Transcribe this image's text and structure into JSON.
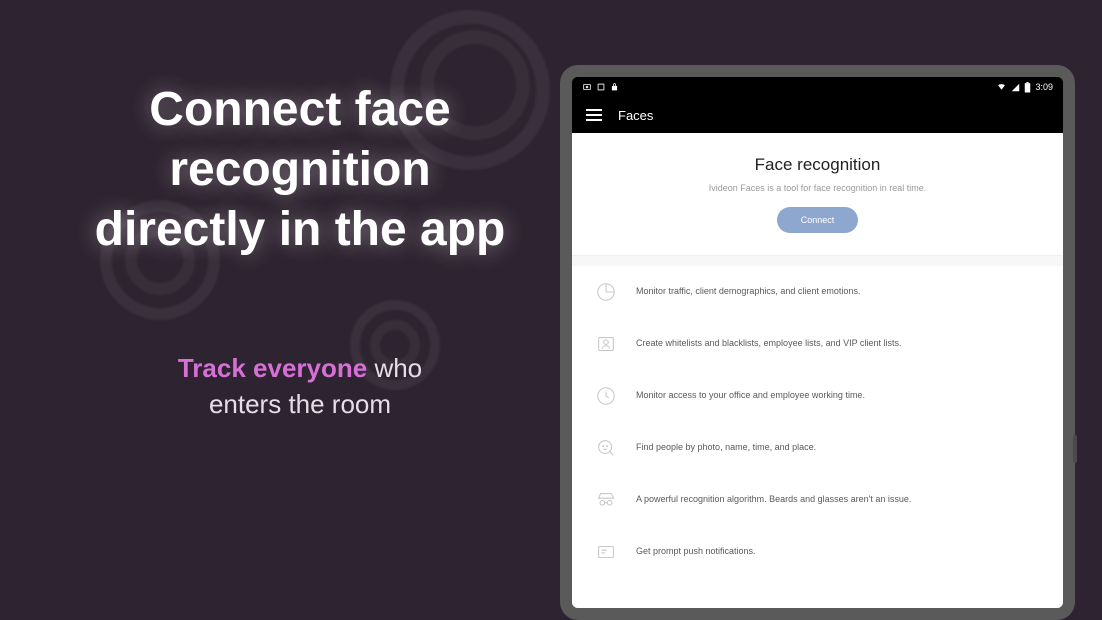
{
  "promo": {
    "headline_line1": "Connect face",
    "headline_line2": "recognition",
    "headline_line3": "directly in the app",
    "sub_highlight": "Track everyone",
    "sub_rest1": " who",
    "sub_rest2": "enters the room"
  },
  "statusbar": {
    "time": "3:09"
  },
  "appbar": {
    "title": "Faces"
  },
  "hero": {
    "title": "Face recognition",
    "subtitle": "Ivideon Faces is a tool for face recognition in real time.",
    "button": "Connect"
  },
  "features": [
    {
      "icon": "pie-chart-icon",
      "text": "Monitor traffic, client demographics, and client emotions."
    },
    {
      "icon": "id-card-icon",
      "text": "Create whitelists and blacklists, employee lists, and VIP client lists."
    },
    {
      "icon": "clock-icon",
      "text": "Monitor access to your office and employee working time."
    },
    {
      "icon": "search-face-icon",
      "text": "Find people by photo, name, time, and place."
    },
    {
      "icon": "incognito-icon",
      "text": "A powerful recognition algorithm. Beards and glasses aren't an issue."
    },
    {
      "icon": "notification-icon",
      "text": "Get prompt push notifications."
    }
  ]
}
